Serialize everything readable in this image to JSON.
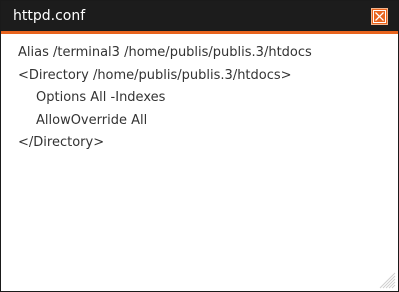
{
  "window": {
    "title": "httpd.conf"
  },
  "content": {
    "lines": [
      "Alias /terminal3 /home/publis/publis.3/htdocs",
      "<Directory /home/publis/publis.3/htdocs>",
      "Options All -Indexes",
      "AllowOverride All",
      "</Directory>"
    ]
  },
  "icons": {
    "close": "close-icon",
    "resize": "resize-grip-icon"
  },
  "colors": {
    "titlebar": "#1c1c1c",
    "accent": "#e8641e",
    "text": "#333333"
  }
}
